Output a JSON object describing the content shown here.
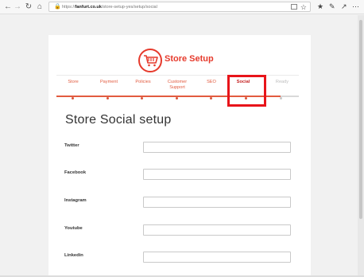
{
  "browser": {
    "url_host": "fanfurt.co.uk",
    "url_path": "/store-setup-yes/setup/social",
    "url_prefix": "https://"
  },
  "logo": {
    "brand_text": "Store Setup"
  },
  "steps": [
    {
      "label": "Store",
      "state": "done"
    },
    {
      "label": "Payment",
      "state": "done"
    },
    {
      "label": "Policies",
      "state": "done"
    },
    {
      "label": "Customer Support",
      "state": "done"
    },
    {
      "label": "SEO",
      "state": "done"
    },
    {
      "label": "Social",
      "state": "active"
    },
    {
      "label": "Ready",
      "state": "disabled"
    }
  ],
  "page": {
    "title": "Store Social setup",
    "fields": [
      {
        "label": "Twitter",
        "value": ""
      },
      {
        "label": "Facebook",
        "value": ""
      },
      {
        "label": "Instagram",
        "value": ""
      },
      {
        "label": "Youtube",
        "value": ""
      },
      {
        "label": "Linkedin",
        "value": ""
      }
    ]
  },
  "colors": {
    "accent": "#e63a2c",
    "highlight": "#e8141a"
  },
  "icons": {
    "logo": "shopping-cart-icon"
  }
}
